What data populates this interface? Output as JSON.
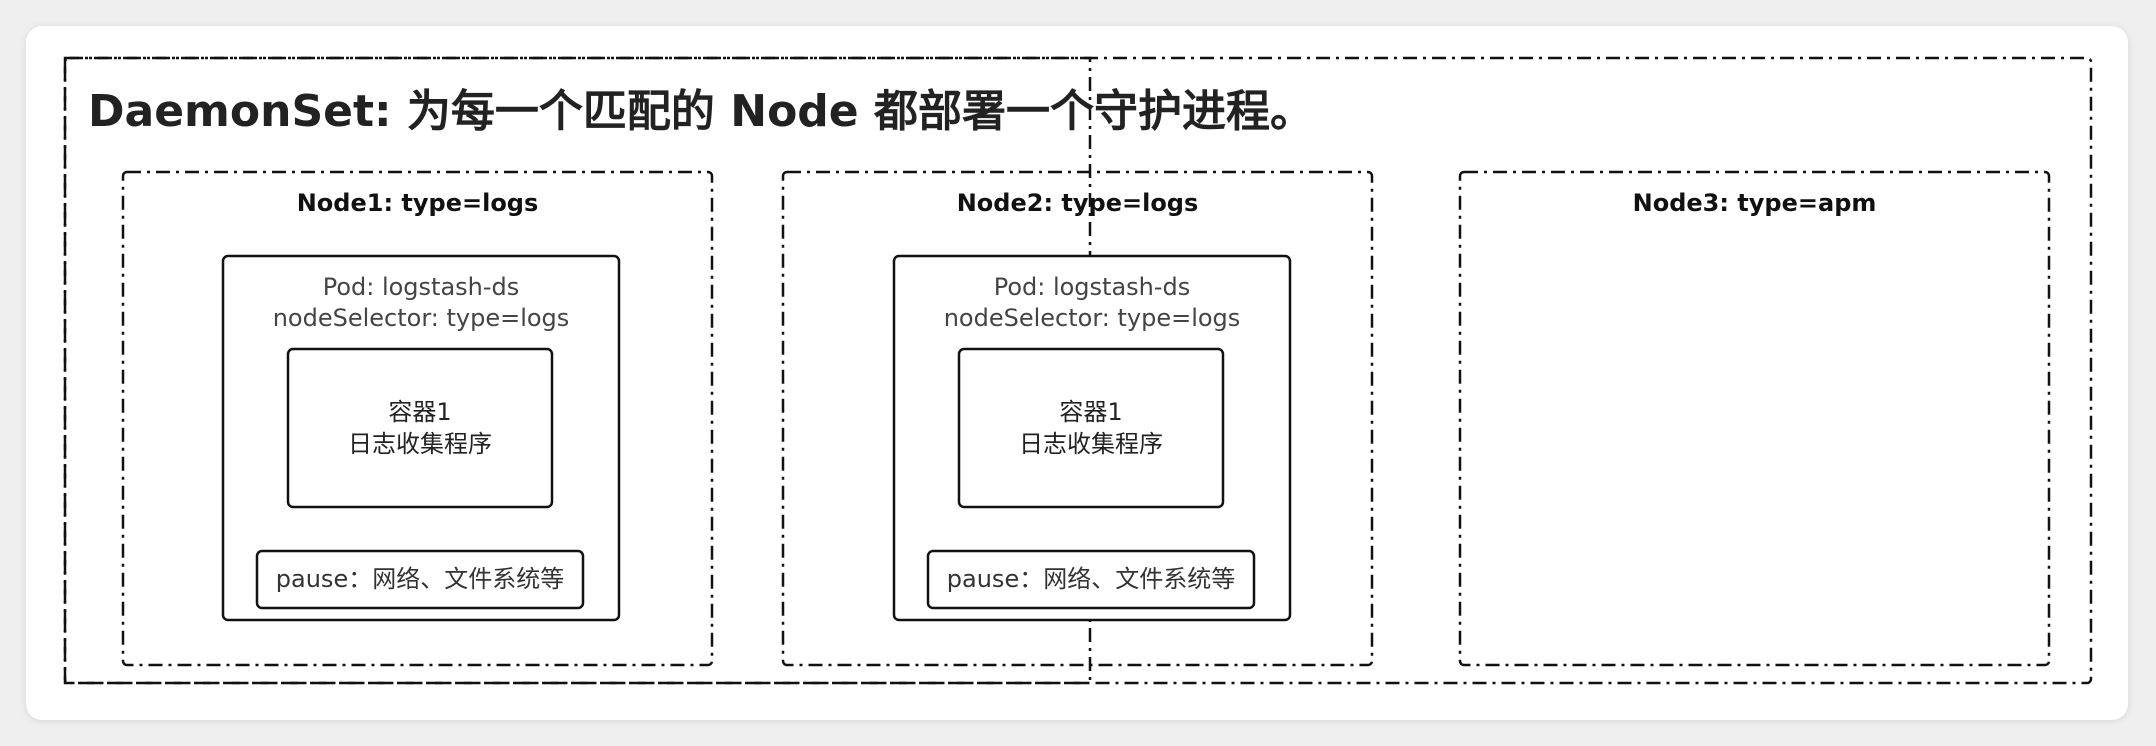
{
  "title": "DaemonSet: 为每一个匹配的 Node 都部署一个守护进程。",
  "nodes": [
    {
      "label": "Node1: type=logs",
      "pod": {
        "name": "Pod: logstash-ds",
        "selector": "nodeSelector: type=logs",
        "container": {
          "name": "容器1",
          "desc": "日志收集程序"
        },
        "pause": "pause：网络、文件系统等"
      }
    },
    {
      "label": "Node2: type=logs",
      "pod": {
        "name": "Pod: logstash-ds",
        "selector": "nodeSelector: type=logs",
        "container": {
          "name": "容器1",
          "desc": "日志收集程序"
        },
        "pause": "pause：网络、文件系统等"
      }
    },
    {
      "label": "Node3: type=apm"
    }
  ]
}
